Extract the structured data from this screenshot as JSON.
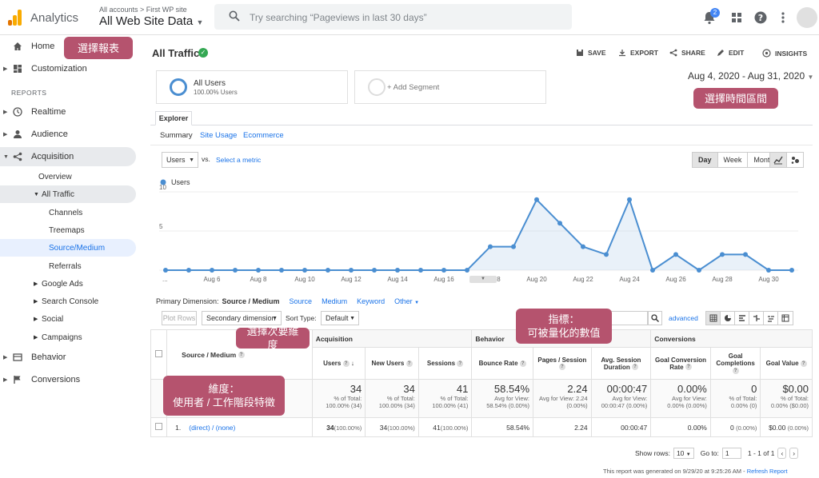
{
  "topbar": {
    "app_name": "Analytics",
    "breadcrumb": "All accounts > First WP site",
    "view_name": "All Web Site Data",
    "search_placeholder": "Try searching “Pageviews in last 30 days”",
    "notif_count": "2"
  },
  "sidebar": {
    "home": "Home",
    "customization": "Customization",
    "reports_header": "REPORTS",
    "realtime": "Realtime",
    "audience": "Audience",
    "acquisition": "Acquisition",
    "overview": "Overview",
    "all_traffic": "All Traffic",
    "channels": "Channels",
    "treemaps": "Treemaps",
    "source_medium": "Source/Medium",
    "referrals": "Referrals",
    "google_ads": "Google Ads",
    "search_console": "Search Console",
    "social": "Social",
    "campaigns": "Campaigns",
    "behavior": "Behavior",
    "conversions": "Conversions"
  },
  "header": {
    "title": "All Traffic",
    "save": "SAVE",
    "export": "EXPORT",
    "share": "SHARE",
    "edit": "EDIT",
    "insights": "INSIGHTS"
  },
  "segments": {
    "seg1_name": "All Users",
    "seg1_pct": "100.00% Users",
    "add_segment": "+ Add Segment"
  },
  "date_range": "Aug 4, 2020 - Aug 31, 2020",
  "tabs": {
    "explorer": "Explorer",
    "summary": "Summary",
    "site_usage": "Site Usage",
    "ecommerce": "Ecommerce"
  },
  "controls": {
    "metric": "Users",
    "vs": "vs.",
    "select_metric": "Select a metric",
    "day": "Day",
    "week": "Week",
    "month": "Month"
  },
  "chart_data": {
    "type": "line",
    "series": [
      {
        "name": "Users",
        "values": [
          0,
          0,
          0,
          0,
          0,
          0,
          0,
          0,
          0,
          0,
          0,
          0,
          0,
          0,
          3,
          3,
          9,
          6,
          3,
          2,
          9,
          0,
          2,
          0,
          2,
          2,
          0,
          0
        ]
      }
    ],
    "x_ticks": [
      "...",
      "Aug 6",
      "Aug 8",
      "Aug 10",
      "Aug 12",
      "Aug 14",
      "Aug 16",
      "Aug 18",
      "Aug 20",
      "Aug 22",
      "Aug 24",
      "Aug 26",
      "Aug 28",
      "Aug 30"
    ],
    "y_ticks": [
      "10",
      "5"
    ],
    "ylim": [
      0,
      10
    ],
    "color": "#4a8ed1"
  },
  "dimensions": {
    "label": "Primary Dimension:",
    "current": "Source / Medium",
    "opt1": "Source",
    "opt2": "Medium",
    "opt3": "Keyword",
    "opt4": "Other"
  },
  "tools": {
    "plot_rows": "Plot Rows",
    "secondary": "Secondary dimension",
    "sort_type_label": "Sort Type:",
    "sort_type": "Default",
    "advanced": "advanced"
  },
  "table": {
    "groups": [
      "Acquisition",
      "Behavior",
      "Conversions"
    ],
    "dim_header": "Source / Medium",
    "columns": [
      "Users",
      "New Users",
      "Sessions",
      "Bounce Rate",
      "Pages / Session",
      "Avg. Session Duration",
      "Goal Conversion Rate",
      "Goal Completions",
      "Goal Value"
    ],
    "totals": [
      {
        "big": "34",
        "small": "% of Total: 100.00% (34)"
      },
      {
        "big": "34",
        "small": "% of Total: 100.00% (34)"
      },
      {
        "big": "41",
        "small": "% of Total: 100.00% (41)"
      },
      {
        "big": "58.54%",
        "small": "Avg for View: 58.54% (0.00%)"
      },
      {
        "big": "2.24",
        "small": "Avg for View: 2.24 (0.00%)"
      },
      {
        "big": "00:00:47",
        "small": "Avg for View: 00:00:47 (0.00%)"
      },
      {
        "big": "0.00%",
        "small": "Avg for View: 0.00% (0.00%)"
      },
      {
        "big": "0",
        "small": "% of Total: 0.00% (0)"
      },
      {
        "big": "$0.00",
        "small": "% of Total: 0.00% ($0.00)"
      }
    ],
    "row1": {
      "index": "1.",
      "dim": "(direct) / (none)",
      "cells": [
        "34",
        "(100.00%)",
        "34",
        "(100.00%)",
        "41",
        "(100.00%)",
        "58.54%",
        "2.24",
        "00:00:47",
        "0.00%",
        "0",
        "(0.00%)",
        "$0.00",
        "(0.00%)"
      ]
    }
  },
  "pager": {
    "show_rows": "Show rows:",
    "rows": "10",
    "goto": "Go to:",
    "page": "1",
    "range": "1 - 1 of 1"
  },
  "footer": {
    "note": "This report was generated on 9/29/20 at 9:25:26 AM - ",
    "refresh": "Refresh Report"
  },
  "annotations": {
    "select_report": "選擇報表",
    "select_date": "選擇時間區間",
    "secondary_dim": "選擇次要維度",
    "metric_line1": "指標：",
    "metric_line2": "可被量化的數值",
    "dim_line1": "維度：",
    "dim_line2": "使用者 / 工作階段特徵"
  }
}
